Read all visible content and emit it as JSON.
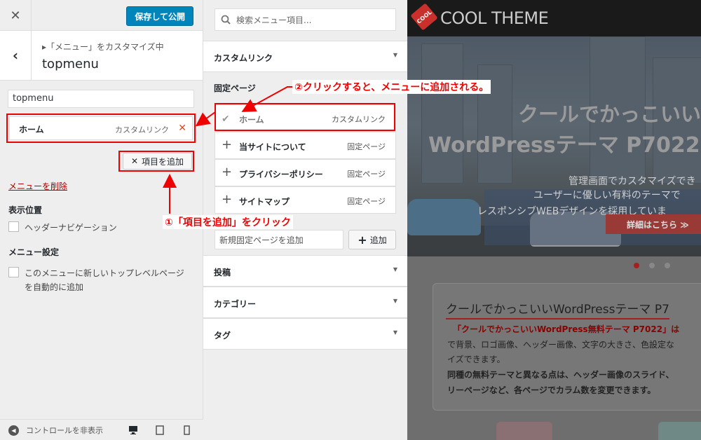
{
  "topbar": {
    "close_icon": "close-icon",
    "save_label": "保存して公開"
  },
  "section": {
    "back_icon": "chevron-left-icon",
    "crumb": "「メニュー」をカスタマイズ中",
    "title": "topmenu"
  },
  "menu": {
    "name_value": "topmenu",
    "items": [
      {
        "title": "ホーム",
        "kind": "カスタムリンク",
        "remove_icon": "remove-icon"
      }
    ],
    "add_items_label": "項目を追加",
    "delete_label": "メニューを削除",
    "position_label": "表示位置",
    "position_option": "ヘッダーナビゲーション",
    "settings_label": "メニュー設定",
    "auto_add_line1": "このメニューに新しいトップレベルページ",
    "auto_add_line2": "を自動的に追加"
  },
  "bottom_bar": {
    "collapse_label": "コントロールを非表示",
    "devices": [
      "desktop-icon",
      "tablet-icon",
      "mobile-icon"
    ]
  },
  "add_panel": {
    "search_placeholder": "検索メニュー項目...",
    "custom_link": "カスタムリンク",
    "fixed_pages_title": "固定ページ",
    "pages": [
      {
        "title": "ホーム",
        "kind": "カスタムリンク",
        "state": "added"
      },
      {
        "title": "当サイトについて",
        "kind": "固定ページ",
        "state": "addable"
      },
      {
        "title": "プライバシーポリシー",
        "kind": "固定ページ",
        "state": "addable"
      },
      {
        "title": "サイトマップ",
        "kind": "固定ページ",
        "state": "addable"
      }
    ],
    "new_page_placeholder": "新規固定ページを追加",
    "new_page_add": "追加",
    "sections": [
      "投稿",
      "カテゴリー",
      "タグ"
    ]
  },
  "preview": {
    "logo_badge": "COOL",
    "logo_text": "COOL THEME",
    "hero_line1": "クールでかっこいい",
    "hero_line2": "WordPressテーマ P7022",
    "hero_sub1": "管理画面でカスタマイズでき",
    "hero_sub2": "ユーザーに優しい有料のテーマで",
    "hero_sub3": "レスポンシブWEBデザインを採用していま",
    "hero_cta": "詳細はこちら ≫",
    "card_title": "クールでかっこいいWordPressテーマ P7",
    "card_l1": "「クールでかっこいいWordPress無料テーマ P7022」は",
    "card_l2": "で背景、ロゴ画像、ヘッダー画像、文字の大きさ、色設定な",
    "card_l3": "イズできます。",
    "card_l4": "同種の無料テーマと異なる点は、ヘッダー画像のスライド、",
    "card_l5": "リーページなど、各ページでカラム数を変更できます。"
  },
  "annotations": {
    "step1": "①「項目を追加」をクリック",
    "step2": "②クリックすると、メニューに追加される。"
  },
  "colors": {
    "primary": "#0085ba",
    "highlight": "#e00000",
    "remove": "#d54e21"
  }
}
